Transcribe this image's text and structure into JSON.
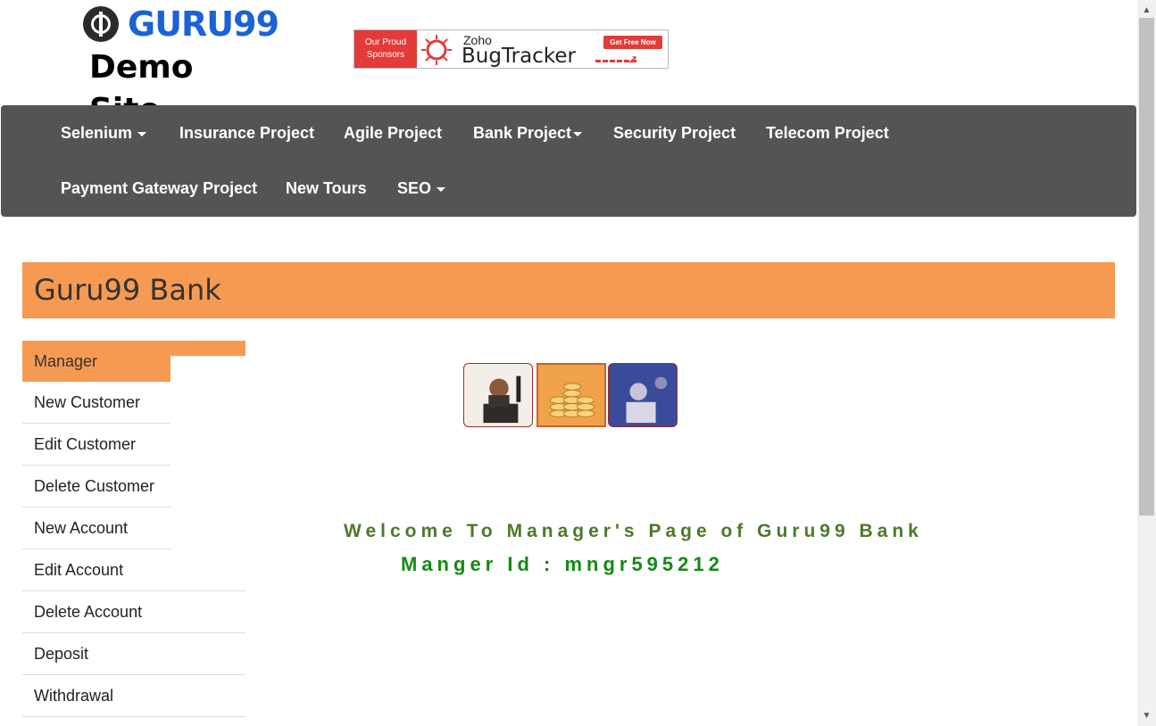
{
  "header": {
    "logo_text": "GURU99",
    "site_title": "Demo Site"
  },
  "ad": {
    "left_text_1": "Our Proud",
    "left_text_2": "Sponsors",
    "brand_small": "Zoho",
    "brand_large": "BugTracker",
    "cta": "Get Free Now"
  },
  "navbar": {
    "items": [
      {
        "label": "Selenium",
        "dropdown": true
      },
      {
        "label": "Insurance Project",
        "dropdown": false
      },
      {
        "label": "Agile Project",
        "dropdown": false
      },
      {
        "label": "Bank Project",
        "dropdown": true
      },
      {
        "label": "Security Project",
        "dropdown": false
      },
      {
        "label": "Telecom Project",
        "dropdown": false
      },
      {
        "label": "Payment Gateway Project",
        "dropdown": false
      },
      {
        "label": "New Tours",
        "dropdown": false
      },
      {
        "label": "SEO",
        "dropdown": true
      }
    ]
  },
  "bank": {
    "title": "Guru99 Bank"
  },
  "sidebar": {
    "items": [
      {
        "label": "Manager"
      },
      {
        "label": "New Customer"
      },
      {
        "label": "Edit Customer"
      },
      {
        "label": "Delete Customer"
      },
      {
        "label": "New Account"
      },
      {
        "label": "Edit Account"
      },
      {
        "label": "Delete Account"
      },
      {
        "label": "Deposit"
      },
      {
        "label": "Withdrawal"
      }
    ]
  },
  "main": {
    "welcome": "Welcome To Manager's Page of Guru99 Bank",
    "manager_id": "Manger Id : mngr595212"
  },
  "colors": {
    "navbar_bg": "#545454",
    "accent_orange": "#f79a51",
    "welcome_green": "#4b7a2a",
    "id_green": "#138a14",
    "logo_blue": "#1a62d6",
    "ad_red": "#e33a3a"
  }
}
